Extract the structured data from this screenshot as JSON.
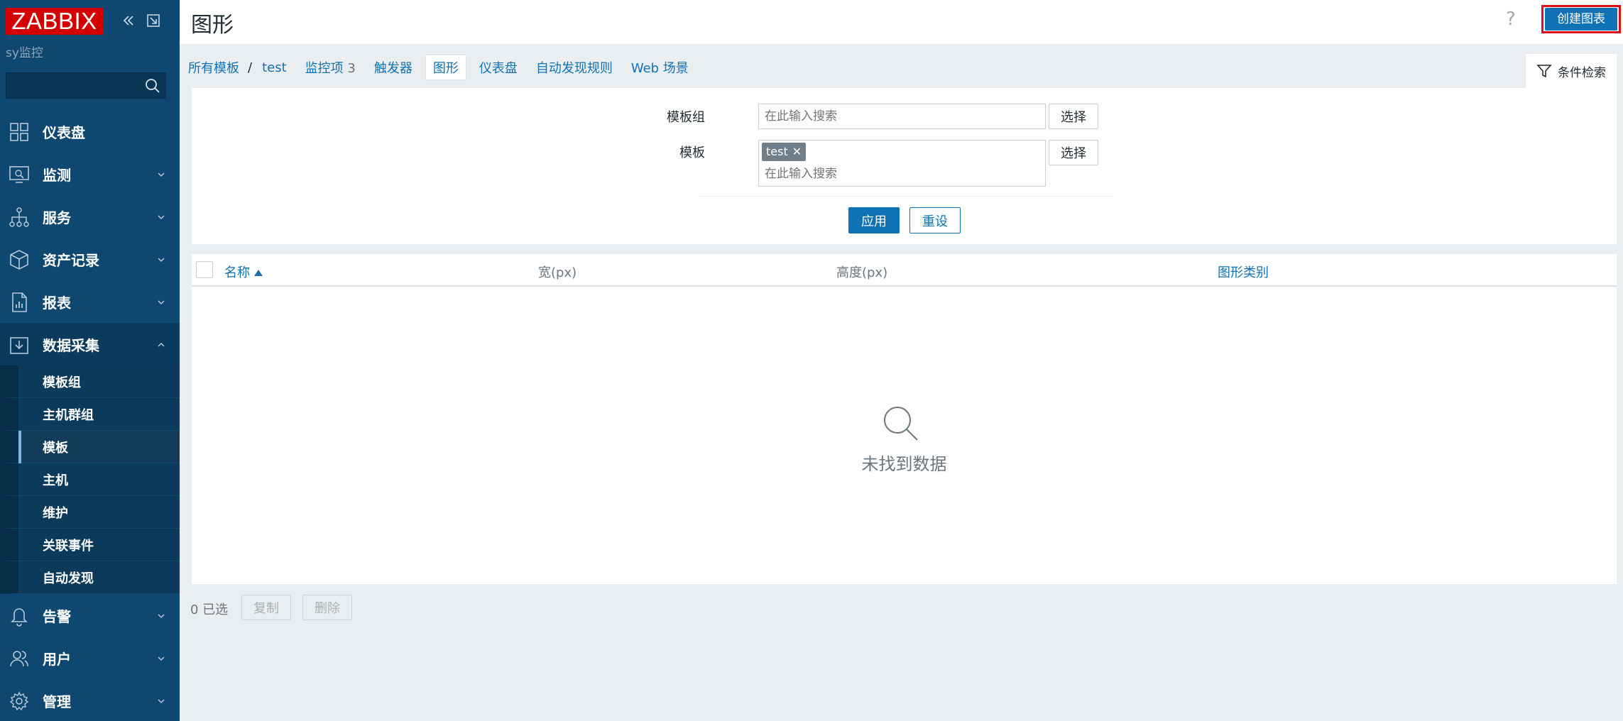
{
  "sidebar": {
    "logo": "ZABBIX",
    "subtitle": "sy监控",
    "search_placeholder": "",
    "items": [
      {
        "label": "仪表盘",
        "icon": "dashboard-icon"
      },
      {
        "label": "监测",
        "icon": "monitoring-icon"
      },
      {
        "label": "服务",
        "icon": "services-icon"
      },
      {
        "label": "资产记录",
        "icon": "inventory-icon"
      },
      {
        "label": "报表",
        "icon": "reports-icon"
      },
      {
        "label": "数据采集",
        "icon": "data-collection-icon"
      },
      {
        "label": "告警",
        "icon": "alerts-icon"
      },
      {
        "label": "用户",
        "icon": "users-icon"
      },
      {
        "label": "管理",
        "icon": "administration-icon"
      }
    ],
    "sub_items": [
      "模板组",
      "主机群组",
      "模板",
      "主机",
      "维护",
      "关联事件",
      "自动发现"
    ],
    "active_sub": "模板"
  },
  "header": {
    "title": "图形",
    "help": "?",
    "create_label": "创建图表"
  },
  "tabs": {
    "all_templates": "所有模板",
    "separator": "/",
    "template": "test",
    "items_label": "监控项",
    "items_count": "3",
    "triggers": "触发器",
    "graphs": "图形",
    "dashboards": "仪表盘",
    "discovery": "自动发现规则",
    "web": "Web 场景",
    "filter": "条件检索"
  },
  "filter": {
    "template_group_label": "模板组",
    "template_label": "模板",
    "placeholder": "在此输入搜索",
    "select_label": "选择",
    "chip": "test",
    "chip_close": "✕",
    "apply_label": "应用",
    "reset_label": "重设"
  },
  "table": {
    "columns": [
      "名称",
      "宽(px)",
      "高度(px)",
      "图形类别"
    ],
    "empty_text": "未找到数据"
  },
  "footer": {
    "selected": "0 已选",
    "copy_label": "复制",
    "delete_label": "删除"
  },
  "colors": {
    "sidebar": "#0e4770",
    "accent": "#0f72b5",
    "logo": "#d40000",
    "highlight": "#e0101a"
  }
}
